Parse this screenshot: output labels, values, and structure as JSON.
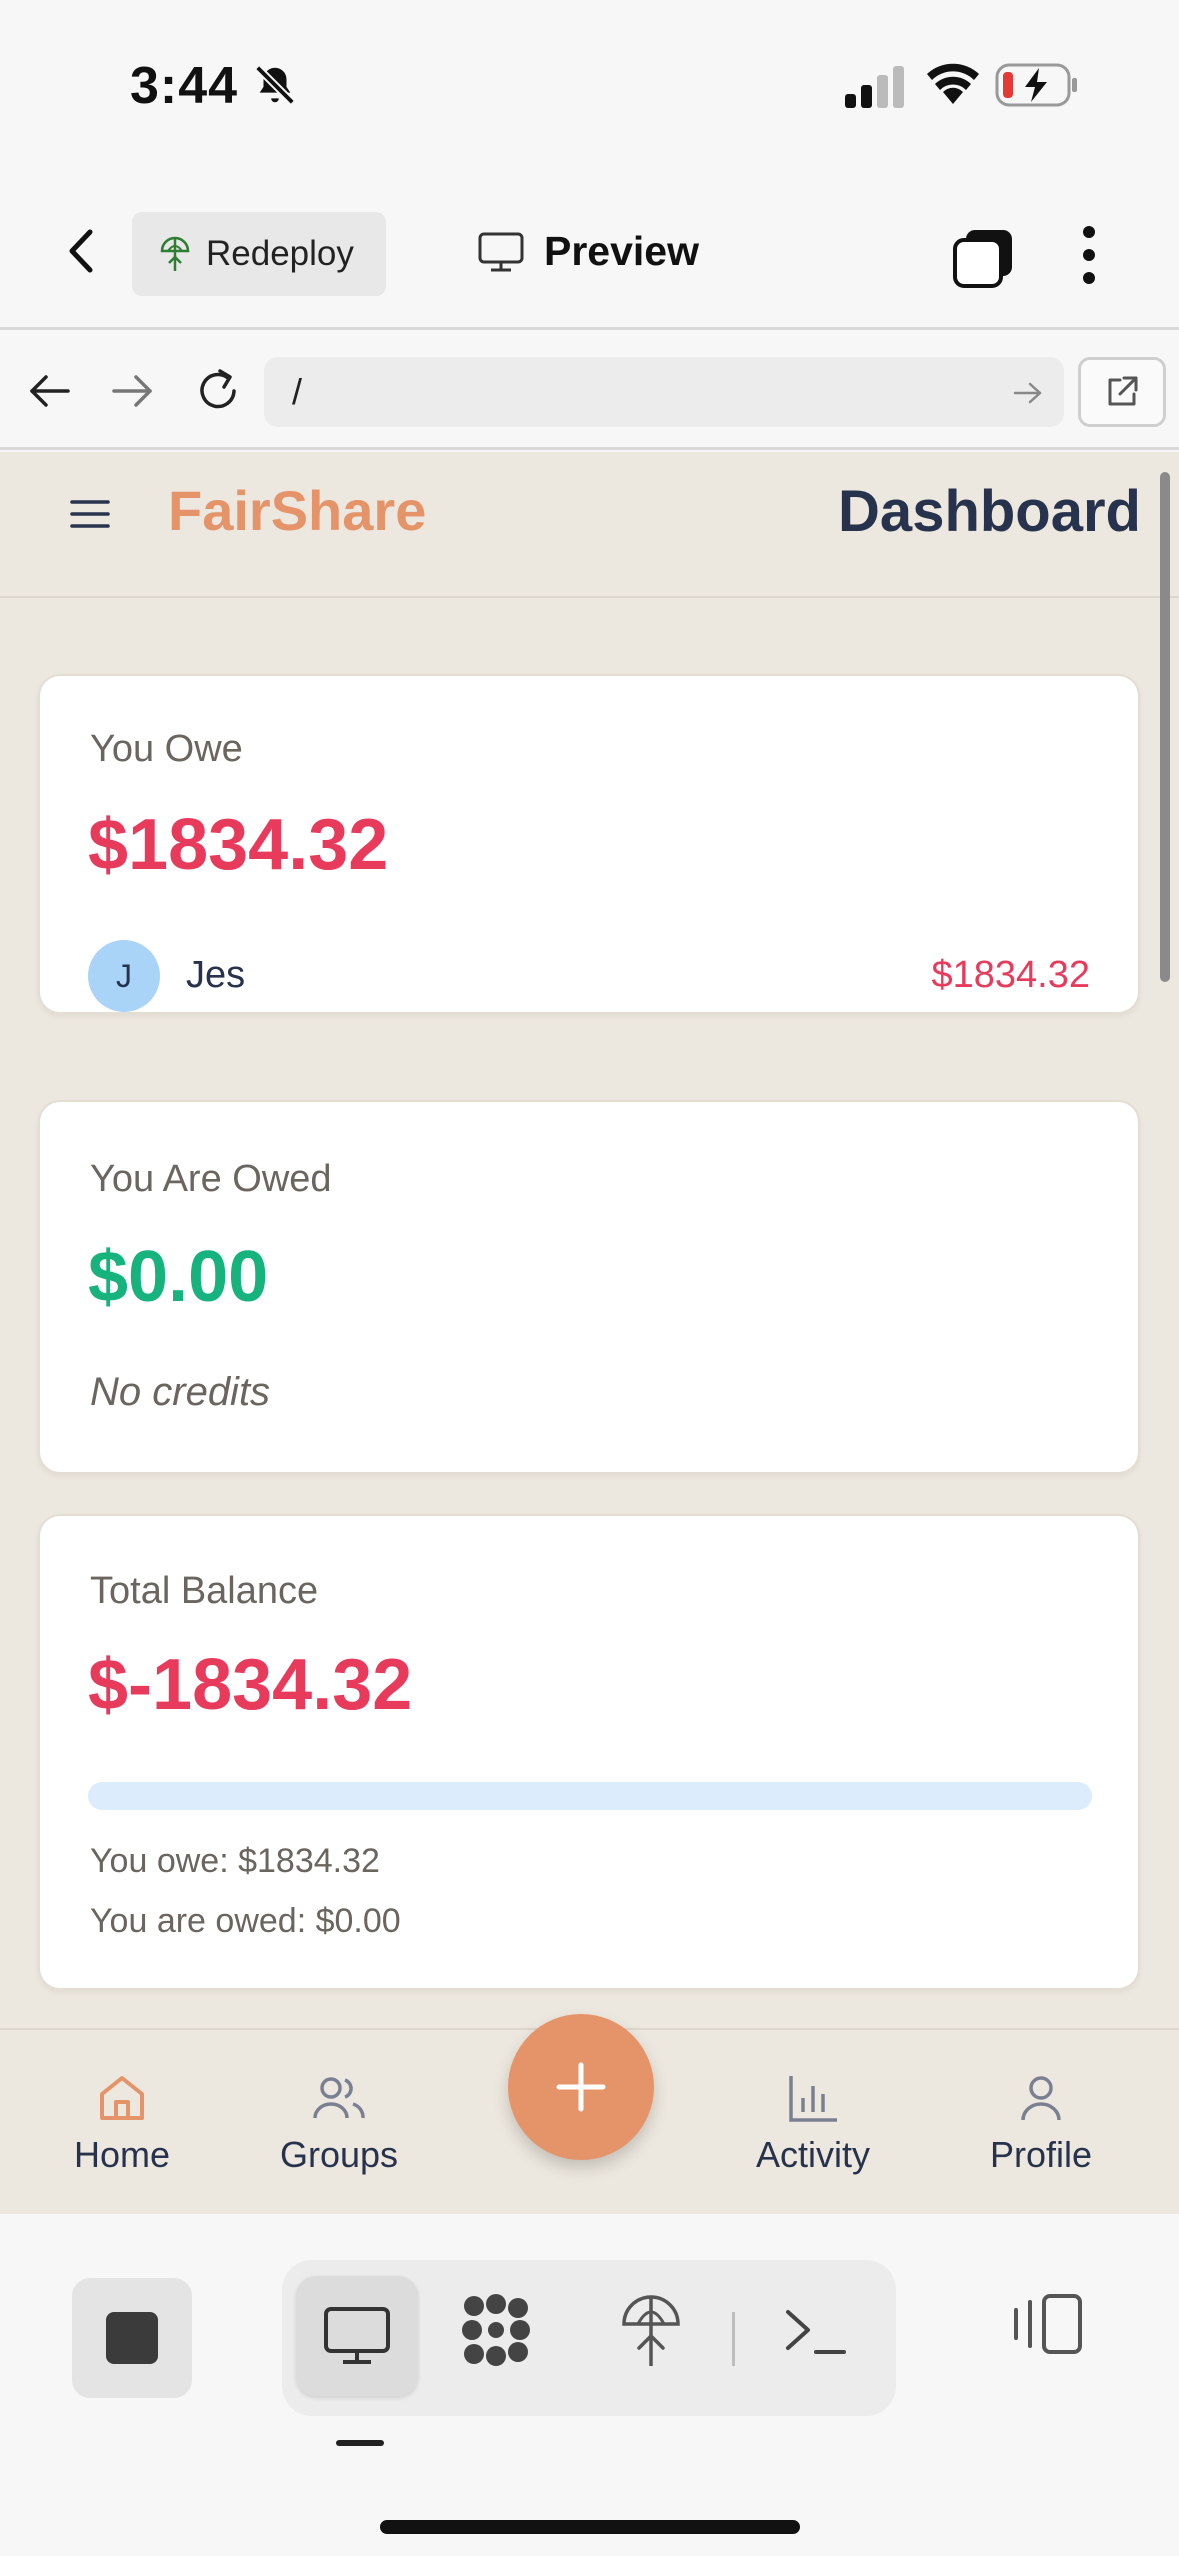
{
  "status_bar": {
    "time": "3:44"
  },
  "top_bar": {
    "redeploy_label": "Redeploy",
    "preview_label": "Preview"
  },
  "url_bar": {
    "path": "/"
  },
  "app": {
    "brand": "FairShare",
    "page_title": "Dashboard",
    "owe_card": {
      "label": "You Owe",
      "amount": "$1834.32",
      "person": {
        "initial": "J",
        "name": "Jes",
        "amount": "$1834.32"
      }
    },
    "owed_card": {
      "label": "You Are Owed",
      "amount": "$0.00",
      "empty_text": "No credits"
    },
    "total_card": {
      "label": "Total Balance",
      "amount": "$-1834.32",
      "owed_fraction": 0,
      "owe_line": "You owe: $1834.32",
      "owed_line": "You are owed: $0.00"
    },
    "bottom_nav": {
      "home": "Home",
      "groups": "Groups",
      "activity": "Activity",
      "profile": "Profile"
    }
  },
  "colors": {
    "accent": "#e59469",
    "negative": "#e83b5c",
    "positive": "#17b37c",
    "navy": "#27324d",
    "background": "#ede8df"
  }
}
